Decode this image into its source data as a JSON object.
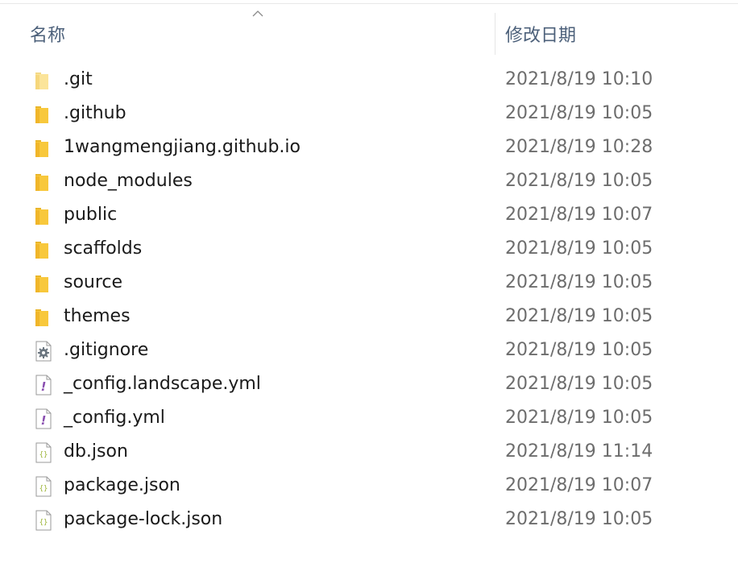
{
  "header": {
    "name_label": "名称",
    "date_label": "修改日期"
  },
  "files": [
    {
      "name": ".git",
      "date": "2021/8/19 10:10",
      "icon": "folder-icon-light"
    },
    {
      "name": ".github",
      "date": "2021/8/19 10:05",
      "icon": "folder-icon"
    },
    {
      "name": "1wangmengjiang.github.io",
      "date": "2021/8/19 10:28",
      "icon": "folder-icon"
    },
    {
      "name": "node_modules",
      "date": "2021/8/19 10:05",
      "icon": "folder-icon"
    },
    {
      "name": "public",
      "date": "2021/8/19 10:07",
      "icon": "folder-icon"
    },
    {
      "name": "scaffolds",
      "date": "2021/8/19 10:05",
      "icon": "folder-icon"
    },
    {
      "name": "source",
      "date": "2021/8/19 10:05",
      "icon": "folder-icon"
    },
    {
      "name": "themes",
      "date": "2021/8/19 10:05",
      "icon": "folder-icon"
    },
    {
      "name": ".gitignore",
      "date": "2021/8/19 10:05",
      "icon": "gear-file-icon"
    },
    {
      "name": "_config.landscape.yml",
      "date": "2021/8/19 10:05",
      "icon": "yml-file-icon"
    },
    {
      "name": "_config.yml",
      "date": "2021/8/19 10:05",
      "icon": "yml-file-icon"
    },
    {
      "name": "db.json",
      "date": "2021/8/19 11:14",
      "icon": "json-file-icon"
    },
    {
      "name": "package.json",
      "date": "2021/8/19 10:07",
      "icon": "json-file-icon"
    },
    {
      "name": "package-lock.json",
      "date": "2021/8/19 10:05",
      "icon": "json-file-icon"
    }
  ],
  "colors": {
    "folder": "#f8c83c",
    "folder_light": "#fbe49a",
    "header_text": "#4c607a",
    "date_text": "#6d6d6d",
    "yml_accent": "#8a4fb0",
    "json_accent": "#9cb437"
  }
}
